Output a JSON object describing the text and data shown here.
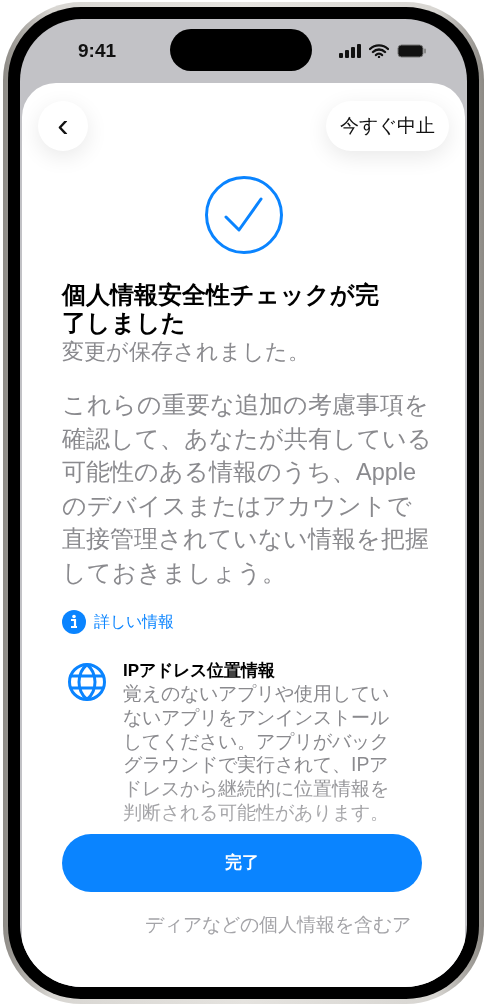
{
  "status_bar": {
    "time": "9:41"
  },
  "nav": {
    "back_label": "‹",
    "stop_label": "今すぐ中止"
  },
  "title": "個人情報安全性チェックが完了しました",
  "subtitle": "変更が保存されました。",
  "body": "これらの重要な追加の考慮事項を確認して、あなたが共有している可能性のある情報のうち、Appleのデバイスまたはアカウントで直接管理されていない情報を把握しておきましょう。",
  "info_link": "詳しい情報",
  "items": [
    {
      "title": "IPアドレス位置情報",
      "description": "覚えのないアプリや使用していないアプリをアンインストールしてください。アプリがバックグラウンドで実行されて、IPアドレスから継続的に位置情報を判断される可能性があります。"
    }
  ],
  "done_button": "完了",
  "trailing_text": "ディアなどの個人情報を含むア"
}
